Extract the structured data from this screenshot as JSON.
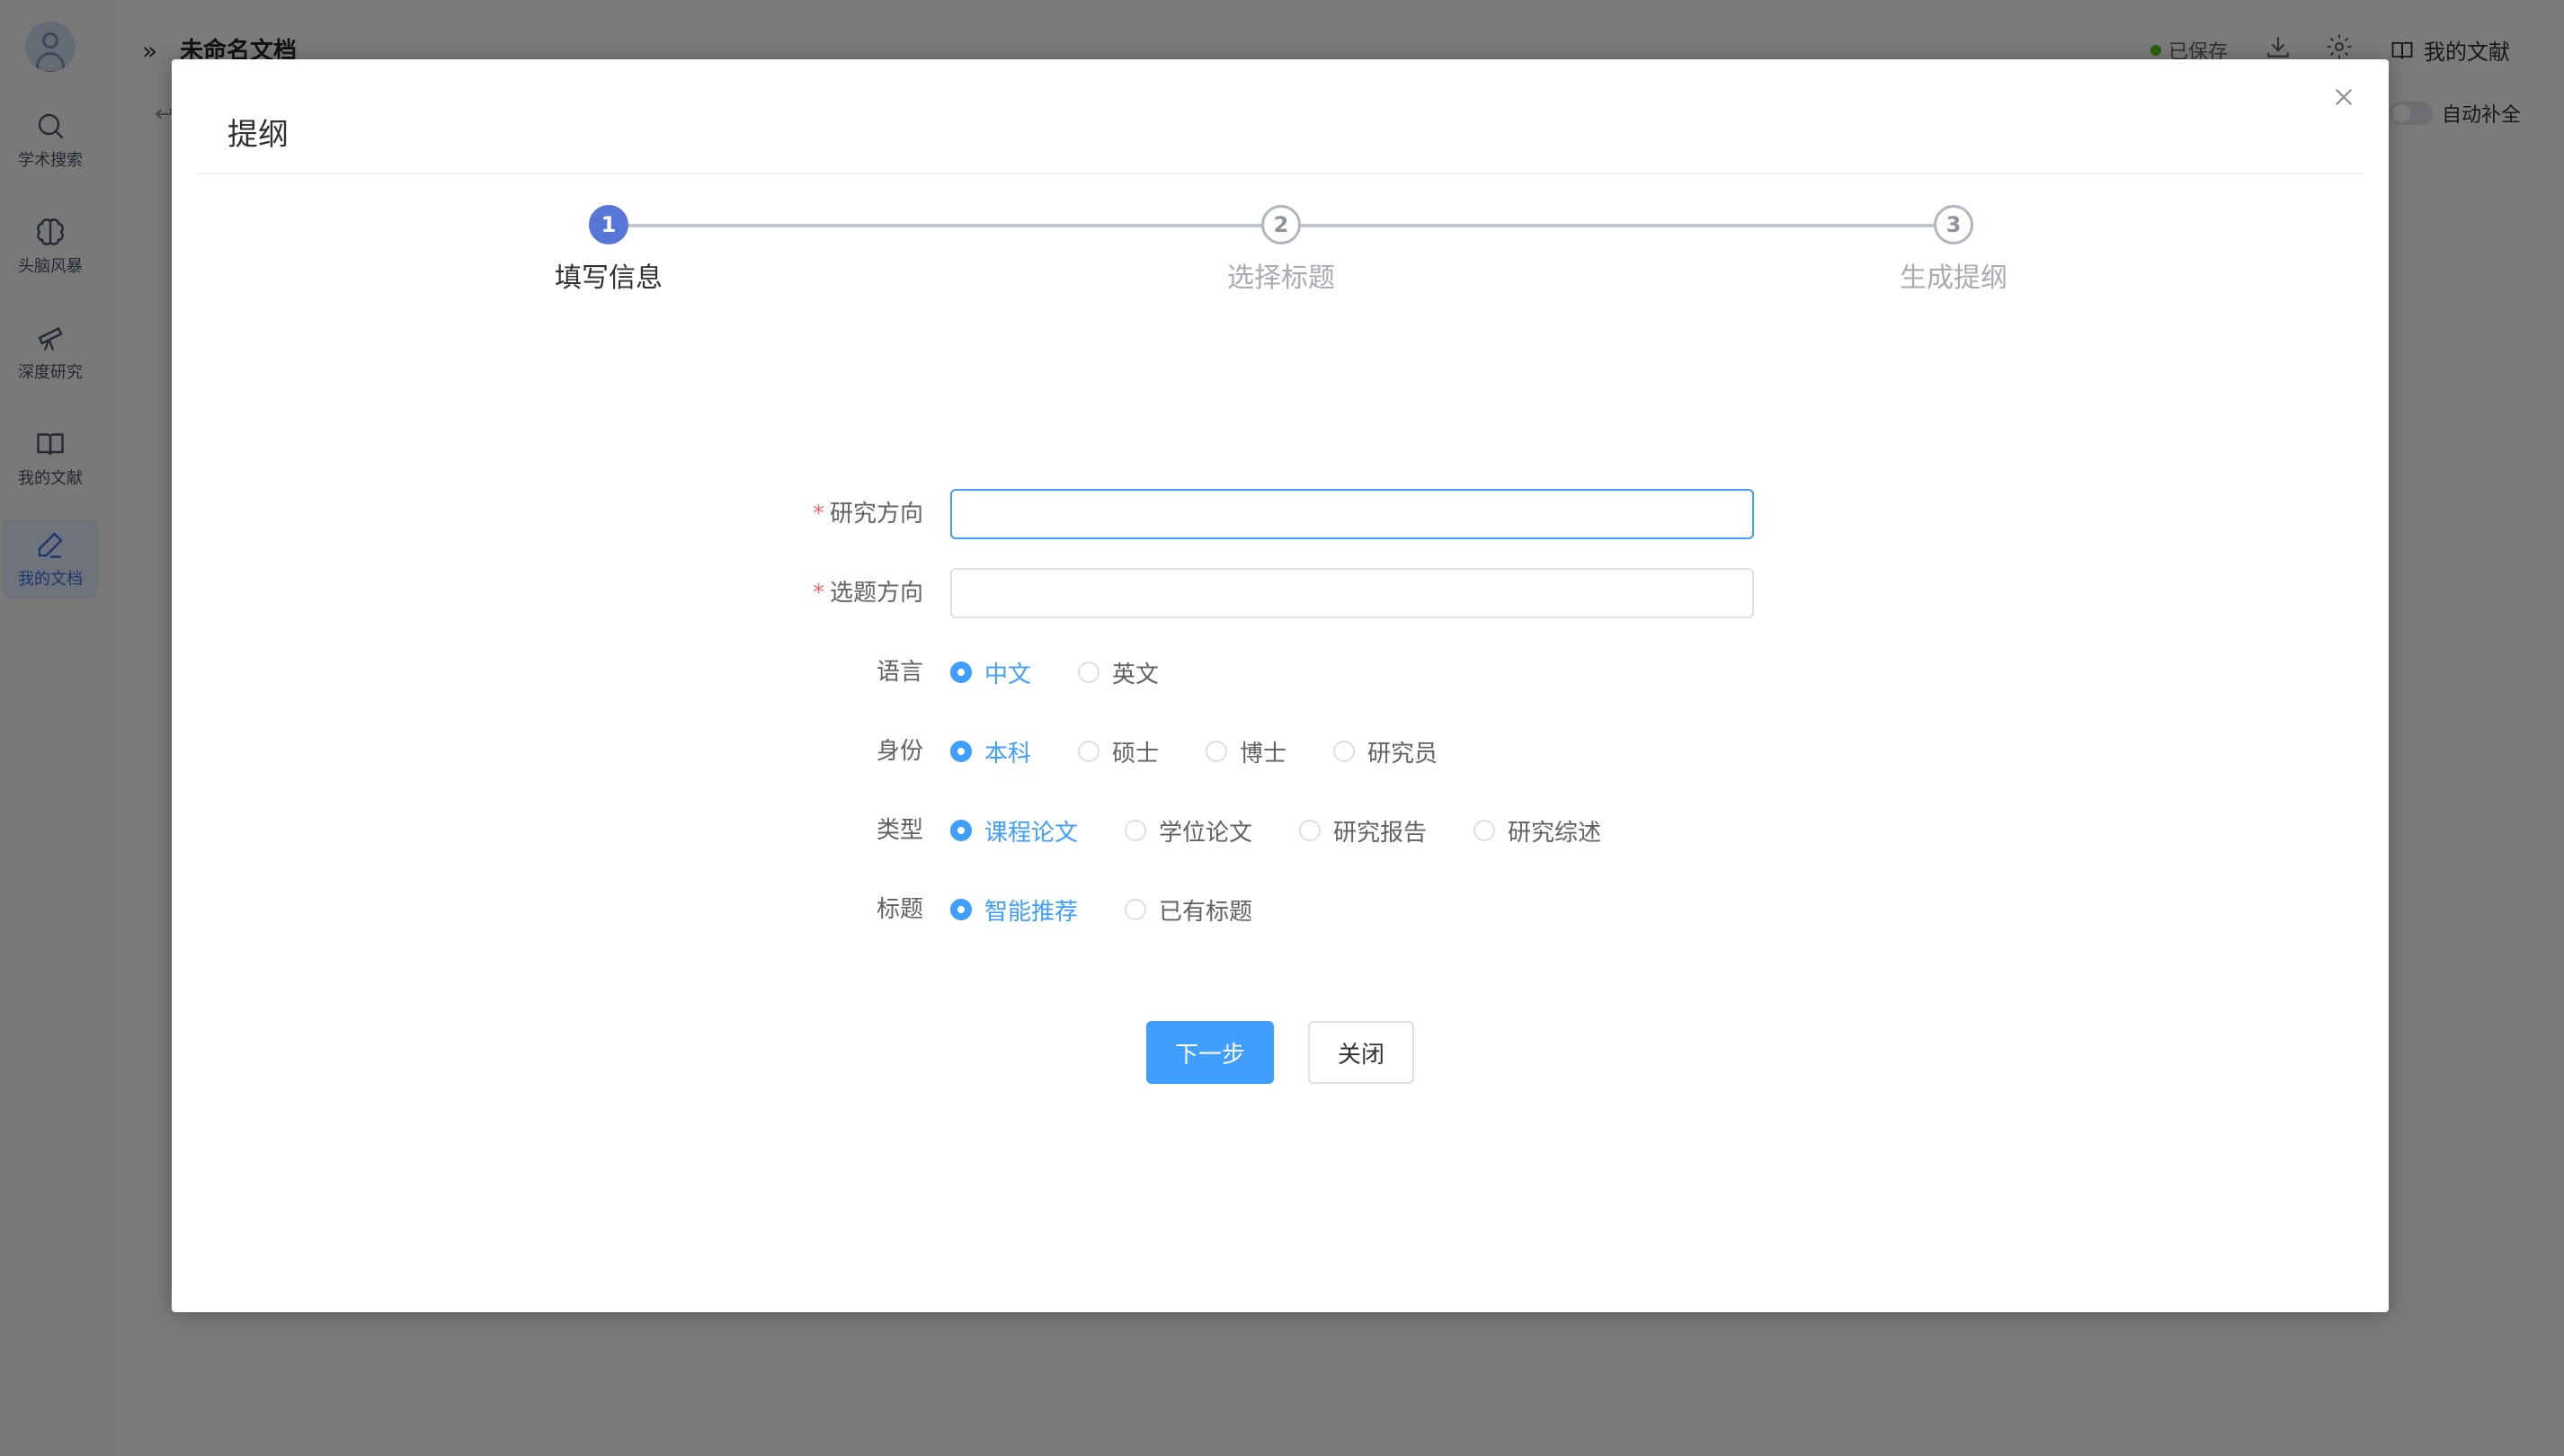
{
  "sidebar": {
    "items": [
      {
        "label": "学术搜索",
        "icon": "search-icon"
      },
      {
        "label": "头脑风暴",
        "icon": "brain-icon"
      },
      {
        "label": "深度研究",
        "icon": "telescope-icon"
      },
      {
        "label": "我的文献",
        "icon": "book-icon"
      },
      {
        "label": "我的文档",
        "icon": "pen-icon",
        "active": true
      }
    ]
  },
  "header": {
    "doc_title": "未命名文档",
    "saved_status": "已保存",
    "my_literature": "我的文献",
    "auto_complete": "自动补全"
  },
  "dialog": {
    "title": "提纲",
    "steps": [
      {
        "number": "1",
        "label": "填写信息",
        "state": "active"
      },
      {
        "number": "2",
        "label": "选择标题",
        "state": "pending"
      },
      {
        "number": "3",
        "label": "生成提纲",
        "state": "pending"
      }
    ],
    "form": {
      "research_direction": {
        "label": "研究方向",
        "value": "",
        "required": true
      },
      "topic_direction": {
        "label": "选题方向",
        "value": "",
        "required": true
      },
      "language": {
        "label": "语言",
        "options": [
          "中文",
          "英文"
        ],
        "selected": "中文"
      },
      "identity": {
        "label": "身份",
        "options": [
          "本科",
          "硕士",
          "博士",
          "研究员"
        ],
        "selected": "本科"
      },
      "type": {
        "label": "类型",
        "options": [
          "课程论文",
          "学位论文",
          "研究报告",
          "研究综述"
        ],
        "selected": "课程论文"
      },
      "title": {
        "label": "标题",
        "options": [
          "智能推荐",
          "已有标题"
        ],
        "selected": "智能推荐"
      }
    },
    "buttons": {
      "next": "下一步",
      "close": "关闭"
    }
  },
  "colors": {
    "primary": "#409eff",
    "step_active": "#5876d8",
    "required": "#f56c6c",
    "saved_dot": "#52c41a"
  }
}
